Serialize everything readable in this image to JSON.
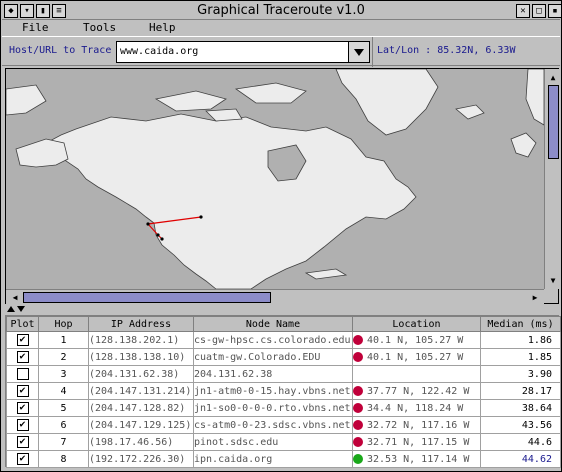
{
  "window": {
    "title": "Graphical Traceroute v1.0"
  },
  "menu": {
    "items": [
      "File",
      "Tools",
      "Help"
    ]
  },
  "toolbar": {
    "host_label": "Host/URL to Trace",
    "host_value": "www.caida.org",
    "latlon": "Lat/Lon : 85.32N, 6.33W"
  },
  "table": {
    "headers": [
      "Plot",
      "Hop",
      "IP Address",
      "Node Name",
      "Location",
      "Median (ms)"
    ],
    "rows": [
      {
        "plot": true,
        "hop": "1",
        "ip": "(128.138.202.1)",
        "node": "cs-gw-hpsc.cs.colorado.edu",
        "dot": "#c0003a",
        "location": "40.1 N, 105.27 W",
        "median": "1.86"
      },
      {
        "plot": true,
        "hop": "2",
        "ip": "(128.138.138.10)",
        "node": "cuatm-gw.Colorado.EDU",
        "dot": "#c0003a",
        "location": "40.1 N, 105.27 W",
        "median": "1.85"
      },
      {
        "plot": false,
        "hop": "3",
        "ip": "(204.131.62.38)",
        "node": "204.131.62.38",
        "dot": "",
        "location": "",
        "median": "3.90"
      },
      {
        "plot": true,
        "hop": "4",
        "ip": "(204.147.131.214)",
        "node": "jn1-atm0-0-15.hay.vbns.net",
        "dot": "#c0003a",
        "location": "37.77 N, 122.42 W",
        "median": "28.17"
      },
      {
        "plot": true,
        "hop": "5",
        "ip": "(204.147.128.82)",
        "node": "jn1-so0-0-0-0.rto.vbns.net",
        "dot": "#c0003a",
        "location": "34.4 N, 118.24 W",
        "median": "38.64"
      },
      {
        "plot": true,
        "hop": "6",
        "ip": "(204.147.129.125)",
        "node": "cs-atm0-0-23.sdsc.vbns.net",
        "dot": "#c0003a",
        "location": "32.72 N, 117.16 W",
        "median": "43.56"
      },
      {
        "plot": true,
        "hop": "7",
        "ip": "(198.17.46.56)",
        "node": "pinot.sdsc.edu",
        "dot": "#c0003a",
        "location": "32.71 N, 117.15 W",
        "median": "44.6"
      },
      {
        "plot": true,
        "hop": "8",
        "ip": "(192.172.226.30)",
        "node": "ipn.caida.org",
        "dot": "#1aa81a",
        "location": "32.53 N,  117.14 W",
        "median": "44.62"
      }
    ]
  }
}
